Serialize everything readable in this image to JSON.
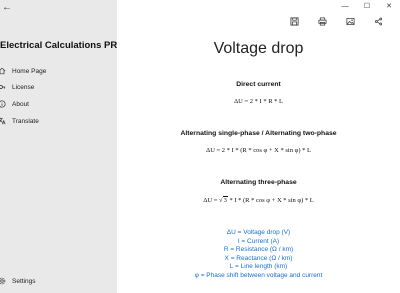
{
  "window": {
    "back_glyph": "←",
    "minimize_glyph": "—",
    "maximize_glyph": "☐",
    "close_glyph": "✕"
  },
  "sidebar": {
    "app_title": "Electrical Calculations PRO",
    "items": [
      {
        "label": "Home Page",
        "icon": "home-icon"
      },
      {
        "label": "License",
        "icon": "license-icon"
      },
      {
        "label": "About",
        "icon": "info-icon"
      },
      {
        "label": "Translate",
        "icon": "translate-icon"
      }
    ],
    "settings_label": "Settings"
  },
  "toolbar": {
    "icons": [
      "save-icon",
      "print-icon",
      "image-icon",
      "share-icon"
    ]
  },
  "content": {
    "title": "Voltage drop",
    "sections": [
      {
        "heading": "Direct current",
        "formula": "ΔU = 2 * I * R * L"
      },
      {
        "heading": "Alternating single-phase / Alternating two-phase",
        "formula": "ΔU = 2 * I * (R * cos φ + X * sin φ) * L"
      },
      {
        "heading": "Alternating three-phase",
        "formula_prefix": "ΔU =",
        "sqrt_arg": "3",
        "formula_suffix": " * I * (R * cos φ + X * sin φ) * L"
      }
    ],
    "legend": [
      "ΔU = Voltage drop (V)",
      "I = Current (A)",
      "R = Resistance (Ω / km)",
      "X = Reactance (Ω / km)",
      "L = Line length (km)",
      "φ = Phase shift between voltage and current"
    ]
  },
  "colors": {
    "sidebar_bg": "#e9e9e9",
    "legend_text": "#1a6fd0"
  }
}
